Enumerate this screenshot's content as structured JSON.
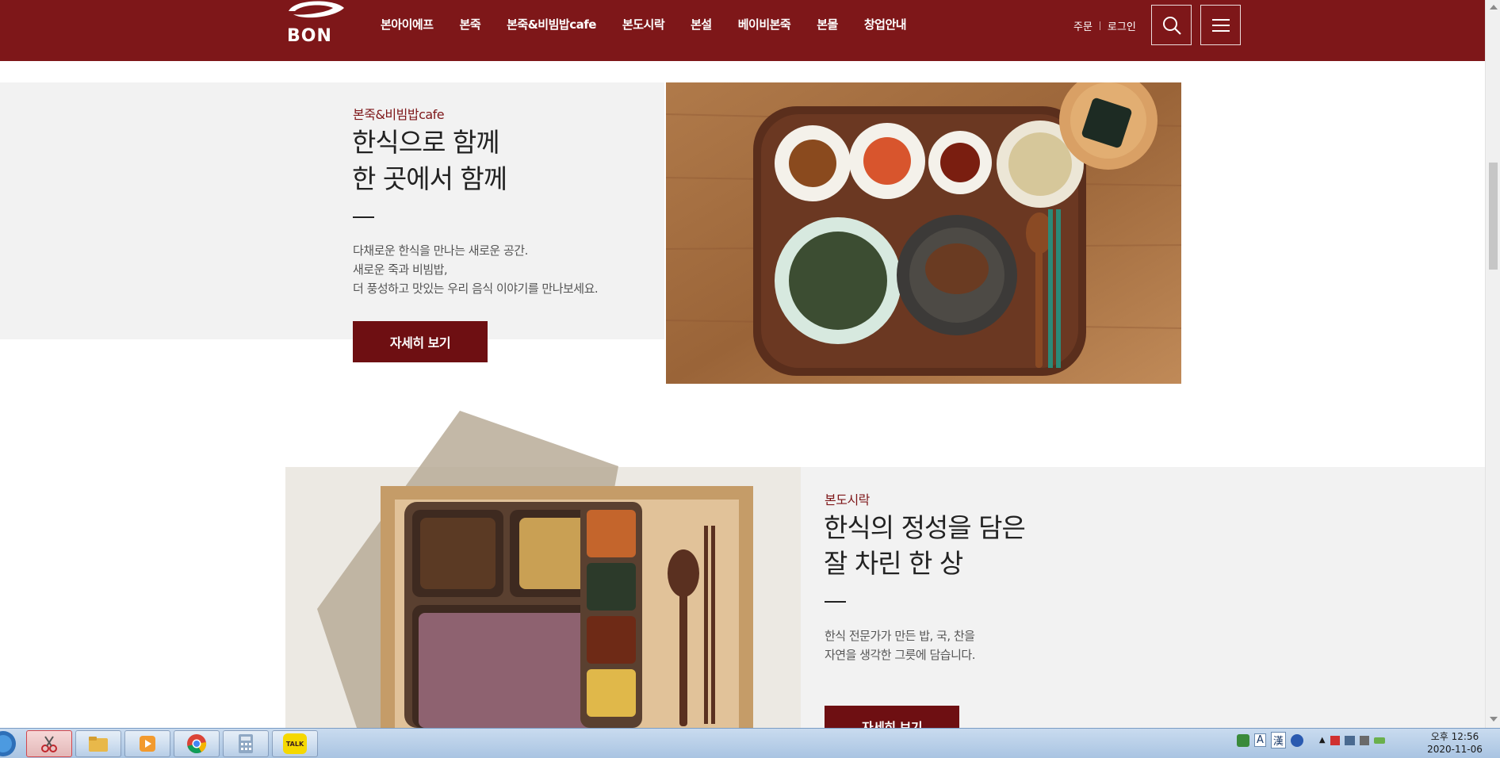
{
  "header": {
    "logo_text": "BON",
    "nav": [
      "본아이에프",
      "본죽",
      "본죽&비빔밥cafe",
      "본도시락",
      "본설",
      "베이비본죽",
      "본몰",
      "창업안내"
    ],
    "util_order": "주문",
    "util_login": "로그인",
    "search_icon": "search-icon",
    "menu_icon": "hamburger-menu-icon",
    "brand_color": "#7e1719"
  },
  "section1": {
    "eyebrow": "본죽&비빔밥cafe",
    "headline_line1": "한식으로 함께",
    "headline_line2": "한 곳에서 함께",
    "desc_line1": "다채로운 한식을 만나는 새로운 공간.",
    "desc_line2": "새로운 죽과 비빔밥,",
    "desc_line3": "더 풍성하고 맛있는 우리 음식 이야기를 만나보세요.",
    "button": "자세히 보기"
  },
  "section2": {
    "eyebrow": "본도시락",
    "headline_line1": "한식의 정성을 담은",
    "headline_line2": "잘 차린 한 상",
    "desc_line1": "한식 전문가가 만든 밥, 국, 찬을",
    "desc_line2": "자연을 생각한 그릇에 담습니다.",
    "button": "자세히 보기"
  },
  "taskbar": {
    "apps": [
      "start-orb",
      "snipping-tool",
      "file-explorer",
      "media-player",
      "chrome",
      "calculator",
      "kakaotalk"
    ],
    "kakao_label": "TALK",
    "ime_a": "A",
    "ime_han": "漢",
    "clock_time": "오후 12:56",
    "clock_date": "2020-11-06"
  }
}
